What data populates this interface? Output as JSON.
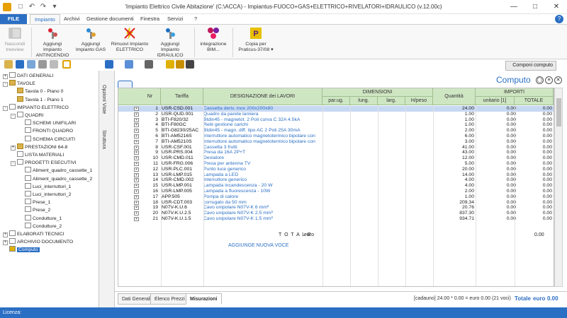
{
  "window": {
    "title": "'Impianto Elettrico Civile Abitazione' (C:\\ACCA) - Impiantus-FUOCO+GAS+ELETTRICO+RIVELATORI+IDRAULICO (v.12.00c)",
    "qat": [
      "□",
      "↶",
      "↷",
      "▾"
    ],
    "min": "—",
    "max": "□",
    "close": "✕"
  },
  "menu": {
    "file": "FILE",
    "tabs": [
      "Impianto",
      "Archivi",
      "Gestione documenti",
      "Finestra",
      "Servizi",
      "?"
    ],
    "help": "?"
  },
  "ribbon": {
    "nascondi": "Nascondi treeview",
    "antincendio": "Aggiungi Impianto ANTINCENDIO",
    "gas": "Aggiungi Impianto GAS",
    "rimuovi": "Rimuovi Impianto ELETTRICO",
    "idraulico": "Aggiungi Impianto IDRAULICO",
    "bim": "integrazione BIM...",
    "copia": "Copia per Praticus-37/08",
    "copia_arrow": "▾"
  },
  "tree": [
    {
      "label": "DATI GENERALI",
      "exp": "+",
      "icon": "doc",
      "indent": 0
    },
    {
      "label": "TAVOLE",
      "exp": "-",
      "icon": "folder",
      "indent": 0
    },
    {
      "label": "Tavola 0 - Piano 0",
      "exp": "",
      "icon": "folder",
      "indent": 1
    },
    {
      "label": "Tavola 1 - Piano 1",
      "exp": "",
      "icon": "folder",
      "indent": 1
    },
    {
      "label": "IMPIANTO ELETTRICO",
      "exp": "-",
      "icon": "doc",
      "indent": 0
    },
    {
      "label": "QUADRI",
      "exp": "-",
      "icon": "doc",
      "indent": 1
    },
    {
      "label": "SCHEMI UNIFILARI",
      "exp": "",
      "icon": "doc",
      "indent": 2
    },
    {
      "label": "FRONTI QUADRO",
      "exp": "",
      "icon": "doc",
      "indent": 2
    },
    {
      "label": "SCHEMA CIRCUITI",
      "exp": "",
      "icon": "doc",
      "indent": 2
    },
    {
      "label": "PRESTAZIONI 64-8",
      "exp": "+",
      "icon": "folder",
      "indent": 1
    },
    {
      "label": "LISTA MATERIALI",
      "exp": "",
      "icon": "doc",
      "indent": 1
    },
    {
      "label": "PROGETTI ESECUTIVI",
      "exp": "-",
      "icon": "doc",
      "indent": 1
    },
    {
      "label": "Aliment_quadro_cassette_1",
      "exp": "",
      "icon": "doc",
      "indent": 2
    },
    {
      "label": "Aliment_quadro_cassette_2",
      "exp": "",
      "icon": "doc",
      "indent": 2
    },
    {
      "label": "Luci_interruttori_1",
      "exp": "",
      "icon": "doc",
      "indent": 2
    },
    {
      "label": "Luci_interruttori_2",
      "exp": "",
      "icon": "doc",
      "indent": 2
    },
    {
      "label": "Prese_1",
      "exp": "",
      "icon": "doc",
      "indent": 2
    },
    {
      "label": "Prese_2",
      "exp": "",
      "icon": "doc",
      "indent": 2
    },
    {
      "label": "Condutture_1",
      "exp": "",
      "icon": "doc",
      "indent": 2
    },
    {
      "label": "Condutture_2",
      "exp": "",
      "icon": "doc",
      "indent": 2
    },
    {
      "label": "ELABORATI TECNICI",
      "exp": "+",
      "icon": "doc",
      "indent": 0
    },
    {
      "label": "ARCHIVIO DOCUMENTO",
      "exp": "+",
      "icon": "doc",
      "indent": 0
    },
    {
      "label": "Computo",
      "exp": "",
      "icon": "comp",
      "indent": 0,
      "selected": true
    }
  ],
  "vtabs": [
    "Opzioni Viste",
    "Struttura"
  ],
  "toolbar": {
    "componi": "Componi computo"
  },
  "grid": {
    "title": "Computo",
    "headers": {
      "nr": "Nr",
      "tariffa": "Tariffa",
      "designazione": "DESIGNAZIONE dei LAVORI",
      "dimensioni": "DIMENSIONI",
      "parug": "par.ug.",
      "lung": "lung.",
      "larg": "larg.",
      "hpeso": "H/peso",
      "quantita": "Quantità",
      "importi": "IMPORTI",
      "unitario": "unitario [1]",
      "totale": "TOTALE"
    },
    "rows": [
      {
        "nr": "1",
        "tar": "USR-CSD.001",
        "des": "Cassetta deriv. inox 200x200x80",
        "q": "24.00",
        "u": "0.00",
        "t": "0.00",
        "sel": true
      },
      {
        "nr": "2",
        "tar": "USR-QUD.001",
        "des": "Quadro da parete lamiera",
        "q": "1.00",
        "u": "0.00",
        "t": "0.00"
      },
      {
        "nr": "3",
        "tar": "BTI-F820/32",
        "des": "Btdin45 - magnetot. 2 Poli curva C 32A 4.5kA",
        "q": "1.00",
        "u": "0.00",
        "t": "0.00"
      },
      {
        "nr": "4",
        "tar": "BTI-F80GC",
        "des": "Relè gestione carichi",
        "q": "1.00",
        "u": "0.00",
        "t": "0.00"
      },
      {
        "nr": "5",
        "tar": "BTI-G8230/25AC",
        "des": "Btdin45 - magn. diff. tipo AC 2 Poli 25A 30mA",
        "q": "2.00",
        "u": "0.00",
        "t": "0.00"
      },
      {
        "nr": "6",
        "tar": "BTI-AM5216S",
        "des": "Interruttore automatico magnetotermico bipolare con",
        "q": "6.00",
        "u": "0.00",
        "t": "0.00"
      },
      {
        "nr": "7",
        "tar": "BTI-AM5210S",
        "des": "Interruttore automatico magnetotermico bipolare con",
        "q": "3.00",
        "u": "0.00",
        "t": "0.00"
      },
      {
        "nr": "8",
        "tar": "USR-CSF.001",
        "des": "Cassetta 3 frutti",
        "q": "41.00",
        "u": "0.00",
        "t": "0.00"
      },
      {
        "nr": "9",
        "tar": "USR-PRS.004",
        "des": "Presa da 16A 2P+T",
        "q": "43.00",
        "u": "0.00",
        "t": "0.00"
      },
      {
        "nr": "10",
        "tar": "USR-CMD.011",
        "des": "Deviatore",
        "q": "12.00",
        "u": "0.00",
        "t": "0.00"
      },
      {
        "nr": "11",
        "tar": "USR-FRG.006",
        "des": "Presa per antenna TV",
        "q": "5.00",
        "u": "0.00",
        "t": "0.00"
      },
      {
        "nr": "12",
        "tar": "USR-PLC.001",
        "des": "Punto luce generico",
        "q": "20.00",
        "u": "0.00",
        "t": "0.00"
      },
      {
        "nr": "13",
        "tar": "USR-LMP.015",
        "des": "Lampada a LED",
        "q": "14.00",
        "u": "0.00",
        "t": "0.00"
      },
      {
        "nr": "14",
        "tar": "USR-CMD.002",
        "des": "Interruttore generico",
        "q": "4.00",
        "u": "0.00",
        "t": "0.00"
      },
      {
        "nr": "15",
        "tar": "USR-LMP.001",
        "des": "Lampada incandescenza - 20 W",
        "q": "4.00",
        "u": "0.00",
        "t": "0.00"
      },
      {
        "nr": "16",
        "tar": "USR-LMP.005",
        "des": "Lampada a fluorescenza - 10W",
        "q": "2.00",
        "u": "0.00",
        "t": "0.00"
      },
      {
        "nr": "17",
        "tar": "APP.505",
        "des": "Pompa di calore",
        "q": "1.00",
        "u": "0.00",
        "t": "0.00"
      },
      {
        "nr": "18",
        "tar": "USR-CDT.003",
        "des": "corrugato da 50 mm",
        "q": "209.34",
        "u": "0.00",
        "t": "0.00"
      },
      {
        "nr": "19",
        "tar": "N07V-K.U.6",
        "des": "Cavo unipolare N07V-K 6 mm²",
        "q": "20.76",
        "u": "0.00",
        "t": "0.00"
      },
      {
        "nr": "20",
        "tar": "N07V-K.U.2.5",
        "des": "Cavo unipolare N07V-K 2.5 mm²",
        "q": "837.30",
        "u": "0.00",
        "t": "0.00"
      },
      {
        "nr": "21",
        "tar": "N07V-K.U.1.5",
        "des": "Cavo unipolare N07V-K 1.5 mm²",
        "q": "934.71",
        "u": "0.00",
        "t": "0.00"
      }
    ],
    "totale_label": "T O T A L E",
    "totale_unit": "euro",
    "totale_value": "0.00",
    "add_row": "AGGIUNGE NUOVA VOCE"
  },
  "bottom": {
    "tabs": [
      "Dati Generali",
      "Elenco Prezzi",
      "Misurazioni"
    ],
    "status": "[cadauno] 24.00 * 0.00 = euro 0.00  (21 voci)",
    "tot_label": "Totale",
    "tot_unit": "euro",
    "tot_value": "0.00"
  },
  "statusbar": {
    "licenza": "Licenza:"
  },
  "colors": {
    "accent": "#2b6fc4",
    "header": "#cfe6c3",
    "selection": "#c7d8f3"
  }
}
